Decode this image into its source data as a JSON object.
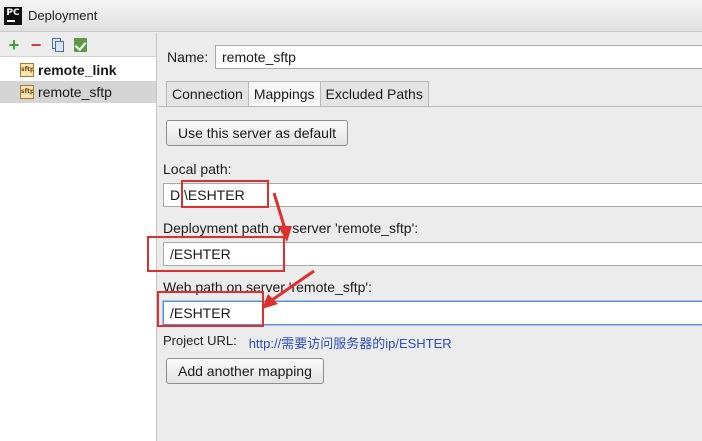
{
  "window": {
    "title": "Deployment",
    "app_logo": "PC"
  },
  "toolbar": {
    "add_icon": "plus-icon",
    "remove_icon": "minus-icon",
    "copy_icon": "copy-icon",
    "check_icon": "check-icon"
  },
  "servers": [
    {
      "label": "remote_link",
      "icon": "sftp",
      "bold": true,
      "selected": false
    },
    {
      "label": "remote_sftp",
      "icon": "sftp",
      "bold": false,
      "selected": true
    }
  ],
  "form": {
    "name_label": "Name:",
    "name_value": "remote_sftp",
    "tabs": [
      {
        "label": "Connection",
        "active": false
      },
      {
        "label": "Mappings",
        "active": true
      },
      {
        "label": "Excluded Paths",
        "active": false
      }
    ],
    "default_button": "Use this server as default",
    "local_path_label": "Local path:",
    "local_path_value": "D:\\ESHTER",
    "deployment_path_label": "Deployment path on server 'remote_sftp':",
    "deployment_path_value": "/ESHTER",
    "web_path_label": "Web path on server 'remote_sftp':",
    "web_path_value": "/ESHTER",
    "project_url_label": "Project URL:",
    "project_url_value": "http://需要访问服务器的ip/ESHTER",
    "add_mapping_button": "Add another mapping"
  },
  "annotation_color": "#e0302d"
}
